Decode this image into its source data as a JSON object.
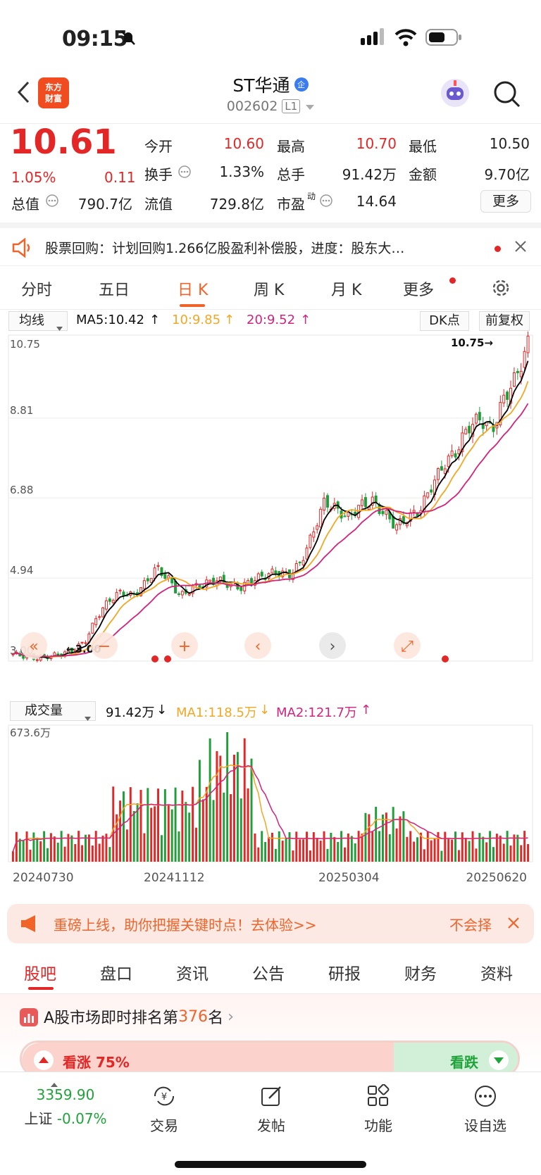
{
  "status_bar": {
    "time": "09:15"
  },
  "header": {
    "back_icon": "chevron-left-icon",
    "logo_text": "东方\n财富",
    "title": "ST华通",
    "badge": "企",
    "code": "002602",
    "level": "L1"
  },
  "quote": {
    "price": "10.61",
    "change_pct": "1.05%",
    "change": "0.11",
    "fields": [
      {
        "label": "今开",
        "value": "10.60"
      },
      {
        "label": "最高",
        "value": "10.70"
      },
      {
        "label": "最低",
        "value": "10.50"
      },
      {
        "label": "换手",
        "value": "1.33%"
      },
      {
        "label": "总手",
        "value": "91.42万"
      },
      {
        "label": "金额",
        "value": "9.70亿"
      },
      {
        "label": "总值",
        "value": "790.7亿"
      },
      {
        "label": "流值",
        "value": "729.8亿"
      },
      {
        "label": "市盈",
        "value": "14.64"
      }
    ],
    "pe_superscript": "动",
    "more_button": "更多"
  },
  "notice": {
    "text": "股票回购：计划回购1.266亿股盈利补偿股，进度：股东大…"
  },
  "chart_tabs": [
    "分时",
    "五日",
    "日 K",
    "周 K",
    "月 K",
    "更多"
  ],
  "chart_tabs_active": 2,
  "chart_header": {
    "ma_select": "均线",
    "ma5": "MA5:10.42",
    "ma10": "10:9.85",
    "ma20": "20:9.52",
    "dk_button": "DK点",
    "adjust_button": "前复权"
  },
  "chart_data": {
    "type": "candlestick",
    "y_ticks": [
      "10.75",
      "8.81",
      "6.88",
      "4.94",
      "3.00"
    ],
    "ylim": [
      3.0,
      10.75
    ],
    "max_label": "10.75",
    "min_label": "3.00",
    "x_ticks": [
      "20240730",
      "20241112",
      "20250304",
      "20250620"
    ],
    "close_series_approx": [
      3.1,
      3.05,
      3.0,
      3.05,
      3.1,
      3.2,
      3.4,
      4.0,
      4.4,
      4.6,
      4.5,
      4.8,
      5.2,
      4.9,
      4.5,
      4.7,
      4.8,
      4.9,
      4.8,
      4.7,
      4.9,
      5.0,
      5.1,
      5.0,
      5.3,
      6.0,
      6.8,
      6.6,
      6.4,
      6.7,
      6.8,
      6.5,
      6.2,
      6.4,
      6.6,
      7.2,
      7.7,
      8.0,
      8.6,
      8.8,
      8.5,
      9.3,
      9.8,
      10.6
    ],
    "volume": {
      "label_select": "成交量",
      "current": "91.42万",
      "ma1": "MA1:118.5万",
      "ma2": "MA2:121.7万",
      "max_label": "673.6万"
    },
    "colors": {
      "up": "#e32626",
      "down": "#1f9e3a",
      "ma5": "#000000",
      "ma10": "#f5a623",
      "ma20": "#d4237a"
    }
  },
  "banner": {
    "text": "重磅上线，助你把握关键时点！去体验>>",
    "dismiss": "不会择"
  },
  "bottom_tabs": [
    "股吧",
    "盘口",
    "资讯",
    "公告",
    "研报",
    "财务",
    "资料"
  ],
  "bottom_tabs_active": 0,
  "rank": {
    "text_prefix": "A股市场即时排名第",
    "rank_num": "376",
    "text_suffix": "名",
    "bull": "看涨 75%",
    "bear": "看跌"
  },
  "bottom_nav": {
    "index_value": "3359.90",
    "index_name": "上证",
    "index_change": "-0.07%",
    "items": [
      "交易",
      "发帖",
      "功能",
      "设自选"
    ]
  }
}
